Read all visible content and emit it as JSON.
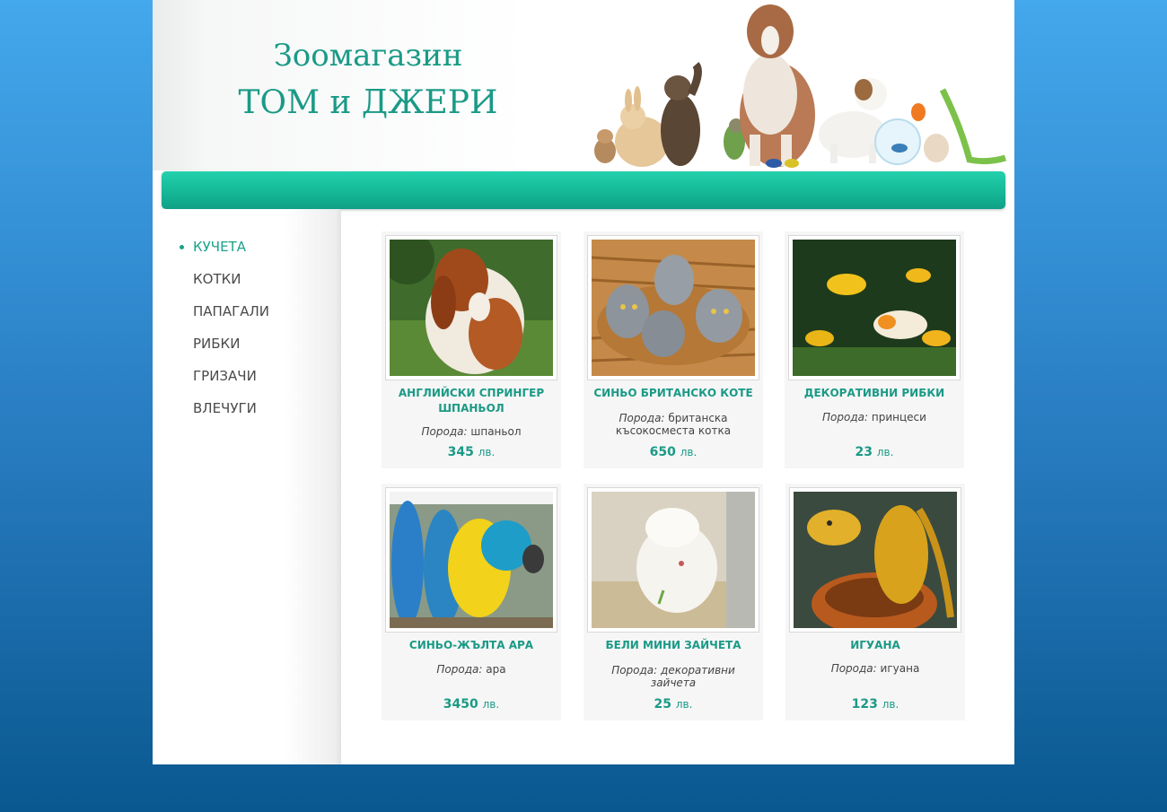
{
  "header": {
    "brand_line1": "Зоомагазин",
    "brand_line2": "ТОМ и ДЖЕРИ"
  },
  "sidebar": {
    "items": [
      {
        "label": "КУЧЕТА",
        "active": true
      },
      {
        "label": "КОТКИ",
        "active": false
      },
      {
        "label": "ПАПАГАЛИ",
        "active": false
      },
      {
        "label": "РИБКИ",
        "active": false
      },
      {
        "label": "ГРИЗАЧИ",
        "active": false
      },
      {
        "label": "ВЛЕЧУГИ",
        "active": false
      }
    ]
  },
  "products": [
    {
      "name": "АНГЛИЙСКИ СПРИНГЕР ШПАНЬОЛ",
      "breed_label": "Порода:",
      "breed": "шпаньол",
      "price": "345",
      "currency": "лв."
    },
    {
      "name": "СИНЬО БРИТАНСКО КОТЕ",
      "breed_label": "Порода:",
      "breed": "британска късокосместа котка",
      "price": "650",
      "currency": "лв."
    },
    {
      "name": "ДЕКОРАТИВНИ РИБКИ",
      "breed_label": "Порода:",
      "breed": "принцеси",
      "price": "23",
      "currency": "лв."
    },
    {
      "name": "СИНЬО-ЖЪЛТА АРА",
      "breed_label": "Порода:",
      "breed": "ара",
      "price": "3450",
      "currency": "лв."
    },
    {
      "name": "БЕЛИ МИНИ ЗАЙЧЕТА",
      "breed_label": "Порода:",
      "breed": "декоративни зайчета",
      "price": "25",
      "currency": "лв."
    },
    {
      "name": "ИГУАНА",
      "breed_label": "Порода:",
      "breed": "игуана",
      "price": "123",
      "currency": "лв."
    }
  ],
  "colors": {
    "accent": "#1a9a86",
    "navbar": "#14b896",
    "background_top": "#44a8ec",
    "background_bottom": "#0a5890"
  }
}
